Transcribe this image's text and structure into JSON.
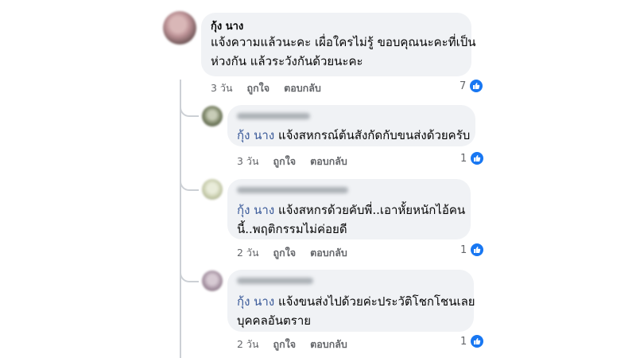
{
  "main_comment": {
    "author": "กุ้ง นาง",
    "lines": [
      "แจ้งความแล้วนะคะ เผื่อใครไม่รู้ ขอบคุณนะคะที่เป็น",
      "ห่วงกัน แล้วระวังกันด้วยนะคะ"
    ],
    "time": "3 วัน",
    "like_label": "ถูกใจ",
    "reply_label": "ตอบกลับ",
    "reactions": "7"
  },
  "replies": [
    {
      "mention": "กุ้ง นาง",
      "line1": " แจ้งสหกรณ์ต้นสังกัดกับขนส่งด้วยครับ",
      "line2": "",
      "time": "3 วัน",
      "like_label": "ถูกใจ",
      "reply_label": "ตอบกลับ",
      "reactions": "1"
    },
    {
      "mention": "กุ้ง นาง",
      "line1": " แจ้งสหกรด้วยคับพี่..เอาหั้ยหนักไอ้คน",
      "line2": "นี้..พฤติกรรมไม่ค่อยดี",
      "time": "2 วัน",
      "like_label": "ถูกใจ",
      "reply_label": "ตอบกลับ",
      "reactions": "1"
    },
    {
      "mention": "กุ้ง นาง",
      "line1": " แจ้งขนส่งไปด้วยค่ะประวัติโชกโชนเลย",
      "line2": "บุคคลอันตราย",
      "time": "2 วัน",
      "like_label": "ถูกใจ",
      "reply_label": "ตอบกลับ",
      "reactions": "1"
    }
  ],
  "colors": {
    "bubble": "#f0f2f5",
    "mention": "#385898",
    "like": "#1877f2",
    "meta": "#65676b"
  },
  "icons": {
    "reaction": "like-thumb-icon",
    "avatar": "blurred-avatar"
  }
}
